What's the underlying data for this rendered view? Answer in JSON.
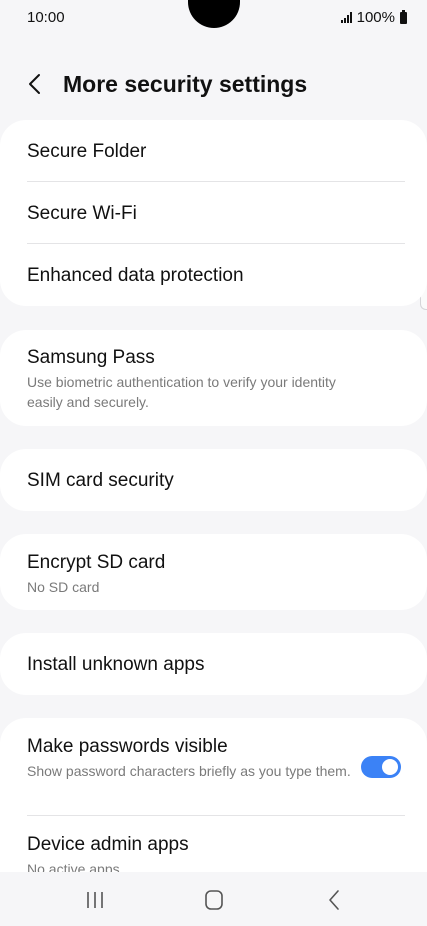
{
  "status": {
    "time": "10:00",
    "battery": "100%"
  },
  "header": {
    "title": "More security settings"
  },
  "groups": [
    {
      "items": [
        {
          "title": "Secure Folder"
        },
        {
          "title": "Secure Wi-Fi"
        },
        {
          "title": "Enhanced data protection"
        }
      ]
    },
    {
      "items": [
        {
          "title": "Samsung Pass",
          "subtitle": "Use biometric authentication to verify your identity easily and securely."
        }
      ]
    },
    {
      "items": [
        {
          "title": "SIM card security"
        }
      ]
    },
    {
      "items": [
        {
          "title": "Encrypt SD card",
          "subtitle": "No SD card"
        }
      ]
    },
    {
      "items": [
        {
          "title": "Install unknown apps"
        }
      ]
    },
    {
      "items": [
        {
          "title": "Make passwords visible",
          "subtitle": "Show password characters briefly as you type them.",
          "toggle_on": true
        },
        {
          "title": "Device admin apps",
          "subtitle": "No active apps"
        }
      ]
    }
  ],
  "colors": {
    "accent": "#3b82f6",
    "background": "#f6f6f8",
    "card": "#ffffff"
  },
  "icons": {
    "back": "chevron-left-icon",
    "nav_recent": "recent-apps-icon",
    "nav_home": "home-icon",
    "nav_back": "back-icon"
  }
}
